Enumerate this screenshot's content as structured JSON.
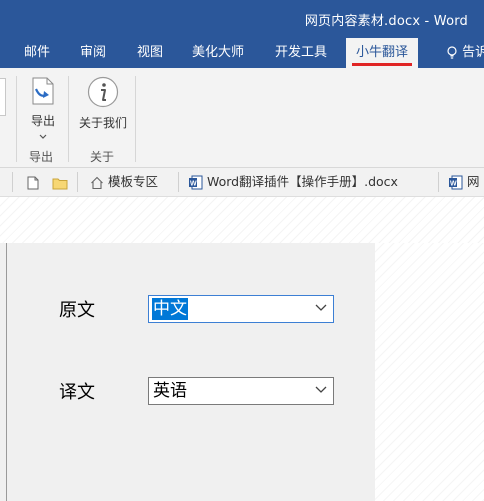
{
  "window": {
    "title": "网页内容素材.docx - Word"
  },
  "ribbon_tabs": [
    {
      "label": "邮件"
    },
    {
      "label": "审阅"
    },
    {
      "label": "视图"
    },
    {
      "label": "美化大师"
    },
    {
      "label": "开发工具"
    },
    {
      "label": "小牛翻译",
      "active": true
    }
  ],
  "tell_me": {
    "label": "告诉"
  },
  "ribbon": {
    "export_button": "导出",
    "export_group": "导出",
    "about_button": "关于我们",
    "about_group": "关于"
  },
  "doc_tabs": {
    "template_zone": "模板专区",
    "doc1": "Word翻译插件【操作手册】.docx",
    "doc2": "网"
  },
  "form": {
    "source_label": "原文",
    "source_value": "中文",
    "target_label": "译文",
    "target_value": "英语"
  },
  "colors": {
    "word_blue": "#2b579a",
    "accent_red": "#e02424",
    "selection_blue": "#0078d7"
  }
}
